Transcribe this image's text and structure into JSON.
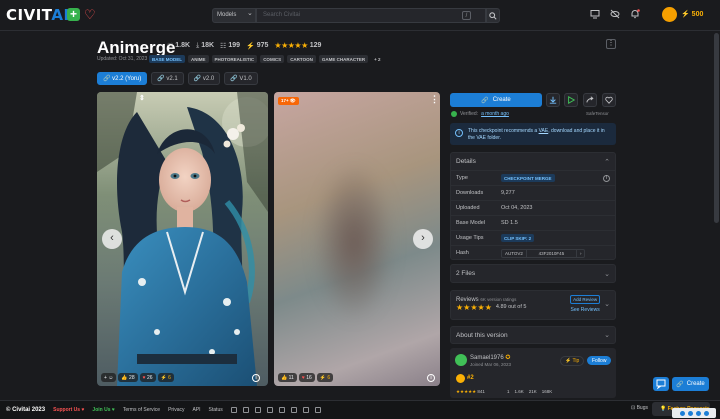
{
  "header": {
    "logo_main": "CIVIT",
    "logo_ai": "AI",
    "search_filter": "Models",
    "search_placeholder": "Search Civitai",
    "search_shortcut": "/",
    "buzz_count": "500"
  },
  "model": {
    "title": "Animerge",
    "stats": {
      "favorites": "1.8K",
      "downloads": "18K",
      "comments": "199",
      "buzz": "975",
      "rating_count": "129"
    },
    "updated": "Updated: Oct 31, 2023",
    "tags": [
      "BASE MODEL",
      "ANIME",
      "PHOTOREALISTIC",
      "COMICS",
      "CARTOON",
      "GAME CHARACTER",
      "+ 2"
    ],
    "versions": [
      "v2.2 (Yoru)",
      "v2.1",
      "v2.0",
      "V1.0"
    ],
    "active_version_index": 0
  },
  "gallery": {
    "image1": {
      "reactions": [
        "28",
        "26",
        "6"
      ]
    },
    "image2": {
      "nsfw_badge": "17+",
      "reactions": [
        "11",
        "16",
        "6"
      ]
    }
  },
  "sidebar": {
    "create_label": "Create",
    "verified_prefix": "Verified:",
    "verified_time": "a month ago",
    "safetensor": "SafeTensor",
    "alert_pre": "This checkpoint recommends a ",
    "alert_link": "VAE",
    "alert_post": ", download and place it in the VAE folder.",
    "details_title": "Details",
    "details": {
      "type_label": "Type",
      "type_value": "CHECKPOINT MERGE",
      "downloads_label": "Downloads",
      "downloads_value": "9,277",
      "uploaded_label": "Uploaded",
      "uploaded_value": "Oct 04, 2023",
      "base_label": "Base Model",
      "base_value": "SD 1.5",
      "usage_label": "Usage Tips",
      "usage_value": "CLIP SKIP: 2",
      "hash_label": "Hash",
      "hash_type": "AUTOV2",
      "hash_value": "43F2010F45"
    },
    "files_title": "2 Files",
    "reviews": {
      "title": "Reviews",
      "subtitle": "6K version ratings",
      "score": "4.89 out of 5",
      "add_label": "Add Review",
      "see_label": "See Reviews"
    },
    "about_title": "About this version",
    "creator": {
      "name": "Samael1976",
      "joined": "Joined Mar 06, 2023",
      "tip_label": "Tip",
      "follow_label": "Follow",
      "rank": "#2",
      "stat_values": [
        "1",
        "1.6K",
        "21K",
        "168K"
      ],
      "extra_stat": "841"
    }
  },
  "footer": {
    "brand": "© Civitai 2023",
    "support": "Support Us",
    "join": "Join Us",
    "links": [
      "Terms of Service",
      "Privacy",
      "API",
      "Status"
    ],
    "bugs": "Bugs",
    "feature": "Feature Requests",
    "create_fab": "Create"
  },
  "colors": {
    "accent": "#1c7ed6",
    "star": "#fab005",
    "bg": "#1a1b1e"
  }
}
